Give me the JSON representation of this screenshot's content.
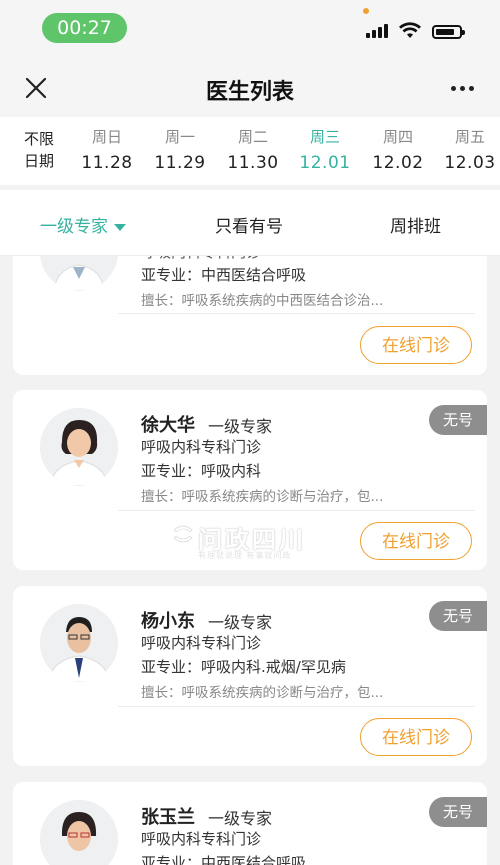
{
  "status_bar": {
    "time": "00:27"
  },
  "navbar": {
    "title": "医生列表"
  },
  "date_strip": {
    "unlimited_line1": "不限",
    "unlimited_line2": "日期",
    "days": [
      {
        "weekday": "周日",
        "date": "11.28"
      },
      {
        "weekday": "周一",
        "date": "11.29"
      },
      {
        "weekday": "周二",
        "date": "11.30"
      },
      {
        "weekday": "周三",
        "date": "12.01",
        "active": true
      },
      {
        "weekday": "周四",
        "date": "12.02"
      },
      {
        "weekday": "周五",
        "date": "12.03"
      }
    ],
    "active_color": "#35b2a0"
  },
  "filters": {
    "level": "一级专家",
    "available_only": "只看有号",
    "weekly_schedule": "周排班"
  },
  "doctors": [
    {
      "name_partial": "呼吸内科专科门诊",
      "subspecialty": "亚专业：中西医结合呼吸",
      "expertise": "擅长：呼吸系统疾病的中西医结合诊治...",
      "consult_label": "在线门诊"
    },
    {
      "name": "徐大华",
      "level": "一级专家",
      "dept": "呼吸内科专科门诊",
      "subspecialty": "亚专业：呼吸内科",
      "expertise": "擅长：呼吸系统疾病的诊断与治疗，包...",
      "consult_label": "在线门诊",
      "badge": "无号"
    },
    {
      "name": "杨小东",
      "level": "一级专家",
      "dept": "呼吸内科专科门诊",
      "subspecialty": "亚专业：呼吸内科.戒烟/罕见病",
      "expertise": "擅长：呼吸系统疾病的诊断与治疗，包...",
      "consult_label": "在线门诊",
      "badge": "无号"
    },
    {
      "name": "张玉兰",
      "level": "一级专家",
      "dept": "呼吸内科专科门诊",
      "subspecialty": "亚专业：中西医结合呼吸",
      "badge": "无号"
    }
  ],
  "watermark": {
    "text": "问政四川",
    "subtext": "有理就说理 有事就问政"
  },
  "colors": {
    "accent": "#35b2a0",
    "consult": "#f0a030",
    "badge": "#8e8e8e",
    "time_pill": "#5ec56a"
  }
}
